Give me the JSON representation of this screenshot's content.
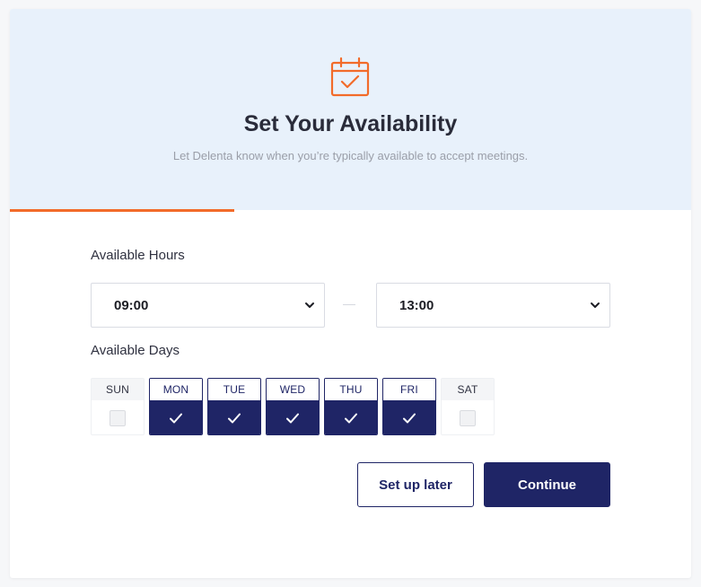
{
  "header": {
    "icon": "calendar-check-icon",
    "title": "Set Your Availability",
    "subtitle": "Let Delenta know when you’re typically available to accept meetings."
  },
  "progress": {
    "percent": 33,
    "color": "#f26b2a"
  },
  "hours": {
    "label": "Available Hours",
    "start": "09:00",
    "end": "13:00"
  },
  "days": {
    "label": "Available Days",
    "items": [
      {
        "label": "SUN",
        "checked": false
      },
      {
        "label": "MON",
        "checked": true
      },
      {
        "label": "TUE",
        "checked": true
      },
      {
        "label": "WED",
        "checked": true
      },
      {
        "label": "THU",
        "checked": true
      },
      {
        "label": "FRI",
        "checked": true
      },
      {
        "label": "SAT",
        "checked": false
      }
    ]
  },
  "actions": {
    "later_label": "Set up later",
    "continue_label": "Continue"
  },
  "colors": {
    "accent": "#f26b2a",
    "primary": "#1f2566",
    "hero_bg": "#e8f1fb"
  }
}
